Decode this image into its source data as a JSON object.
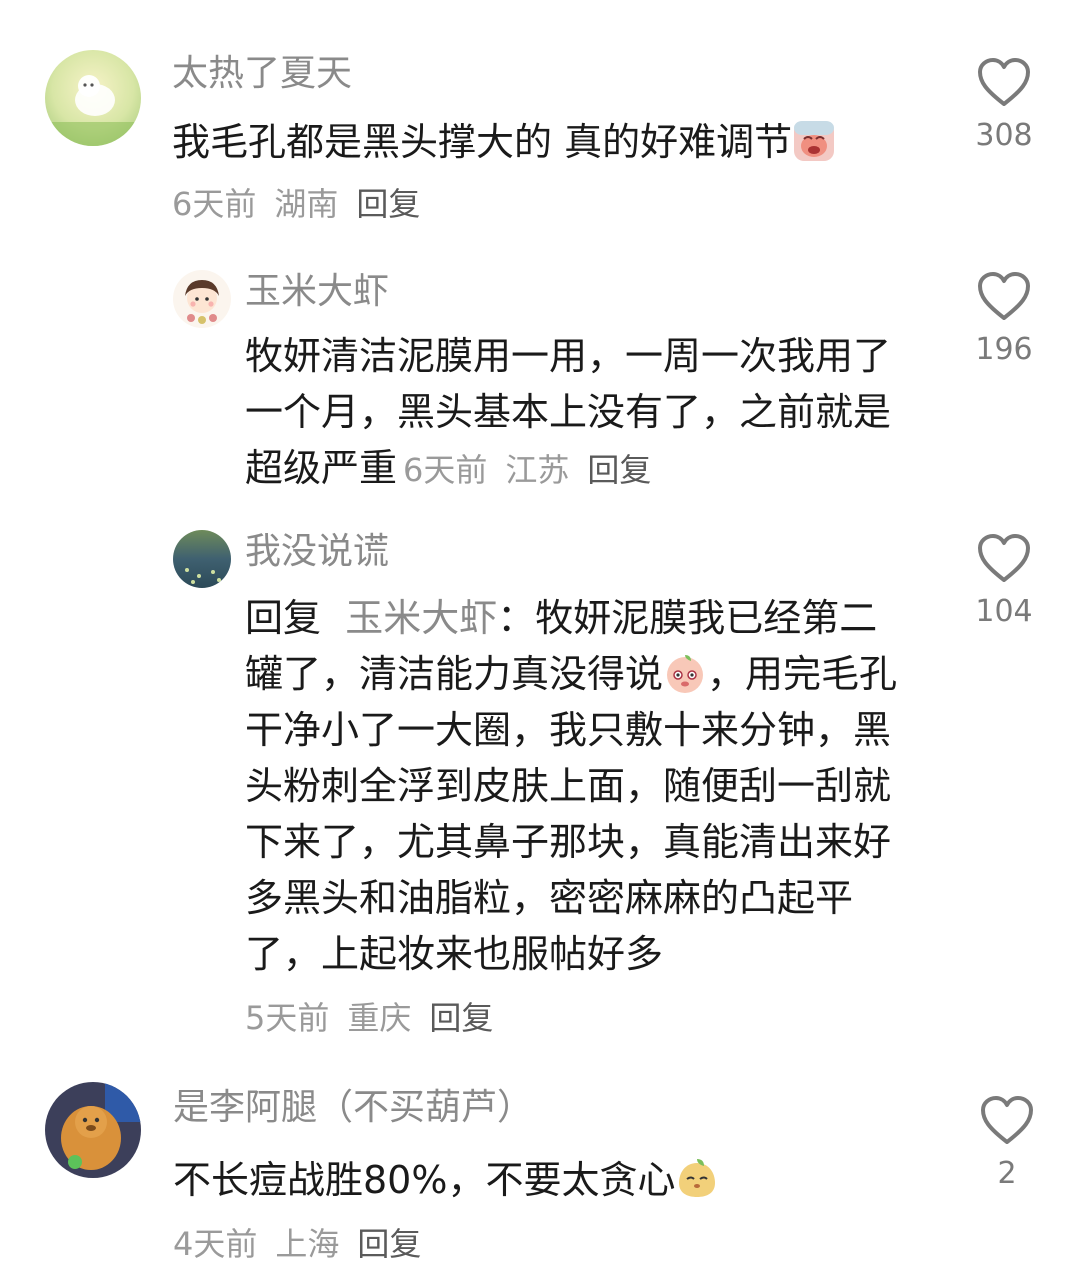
{
  "comments": [
    {
      "username": "太热了夏天",
      "text": "我毛孔都是黑头撑大的 真的好难调节",
      "emoji": "crying-face-emoji",
      "time": "6天前",
      "location": "湖南",
      "reply_label": "回复",
      "likes": "308"
    },
    {
      "username": "玉米大虾",
      "text": "牧妍清洁泥膜用一用，一周一次我用了一个月，黑头基本上没有了，之前就是超级严重",
      "time": "6天前",
      "location": "江苏",
      "reply_label": "回复",
      "likes": "196"
    },
    {
      "username": "我没说谎",
      "reply_prefix": "回复",
      "reply_to": "玉米大虾",
      "text_part1": "：牧妍泥膜我已经第二罐了，清洁能力真没得说",
      "emoji": "shy-face-emoji",
      "text_part2": "，用完毛孔干净小了一大圈，我只敷十来分钟，黑头粉刺全浮到皮肤上面，随便刮一刮就下来了，尤其鼻子那块，真能清出来好多黑头和油脂粒，密密麻麻的凸起平了，上起妆来也服帖好多",
      "time": "5天前",
      "location": "重庆",
      "reply_label": "回复",
      "likes": "104"
    },
    {
      "username": "是李阿腿（不买葫芦）",
      "text": "不长痘战胜80%，不要太贪心",
      "emoji": "smug-face-emoji",
      "time": "4天前",
      "location": "上海",
      "reply_label": "回复",
      "likes": "2"
    }
  ],
  "icons": {
    "like": "heart-outline-icon"
  },
  "colors": {
    "username": "#8a8a8a",
    "body_text": "#1a1a1a",
    "meta": "#9a9a9a",
    "reply": "#5a5a5a"
  }
}
